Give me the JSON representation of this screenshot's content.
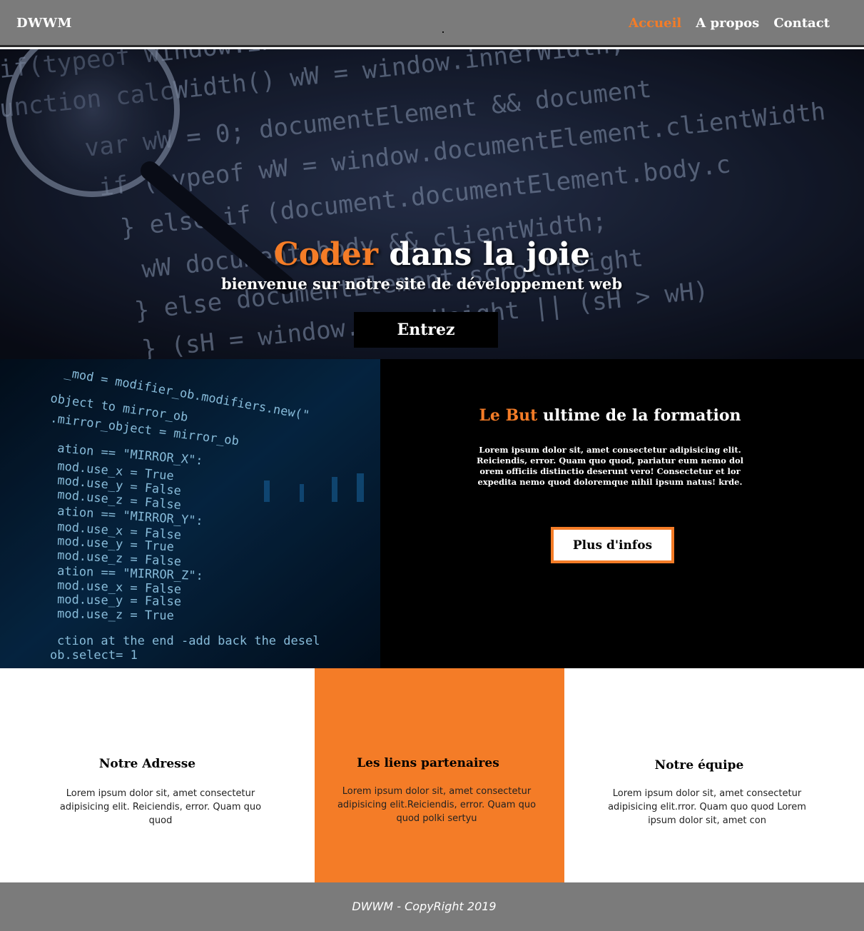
{
  "header": {
    "brand": "DWWM",
    "nav": [
      {
        "label": "Accueil",
        "active": true
      },
      {
        "label": "A propos",
        "active": false
      },
      {
        "label": "Contact",
        "active": false
      }
    ]
  },
  "hero": {
    "title_accent": "Coder",
    "title_rest": " dans la joie",
    "subtitle": "bienvenue sur notre site de développement web",
    "button": "Entrez"
  },
  "mission": {
    "title_accent": "Le But",
    "title_rest": " ultime de la formation",
    "paragraph": "Lorem ipsum dolor sit, amet consectetur adipisicing elit. Reiciendis, error. Quam quo quod, pariatur eum nemo dol orem officiis distinctio deserunt vero! Consectetur et lor expedita nemo quod doloremque nihil ipsum natus! krde.",
    "button": "Plus d'infos"
  },
  "columns": [
    {
      "title": "Notre Adresse",
      "text": "Lorem ipsum dolor sit, amet consectetur adipisicing elit.  Reiciendis, error. Quam quo quod"
    },
    {
      "title": "Les liens partenaires",
      "text": "Lorem ipsum dolor sit, amet consectetur adipisicing elit.Reiciendis, error. Quam quo quod polki sertyu"
    },
    {
      "title": "Notre équipe",
      "text": "Lorem ipsum dolor sit, amet consectetur adipisicing elit.rror. Quam quo quod Lorem ipsum dolor sit, amet con"
    }
  ],
  "footer": {
    "copyright": "DWWM - CopyRight 2019"
  },
  "colors": {
    "accent": "#f47c27",
    "header_bg": "#7b7b7b",
    "dark": "#000000"
  }
}
